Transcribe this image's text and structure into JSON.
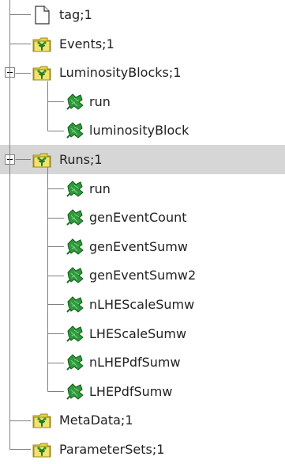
{
  "tree": {
    "nodes": [
      {
        "id": "tag",
        "label": "tag;1",
        "icon": "file-icon",
        "depth": 0,
        "selected": false
      },
      {
        "id": "events",
        "label": "Events;1",
        "icon": "tree-folder-icon",
        "depth": 0,
        "selected": false
      },
      {
        "id": "lumi",
        "label": "LuminosityBlocks;1",
        "icon": "tree-folder-icon",
        "depth": 0,
        "expanded": true,
        "selected": false
      },
      {
        "id": "lumi-run",
        "label": "run",
        "icon": "leaf-branch-icon",
        "depth": 1,
        "selected": false
      },
      {
        "id": "lumi-lb",
        "label": "luminosityBlock",
        "icon": "leaf-branch-icon",
        "depth": 1,
        "selected": false
      },
      {
        "id": "runs",
        "label": "Runs;1",
        "icon": "tree-folder-icon",
        "depth": 0,
        "expanded": true,
        "selected": true
      },
      {
        "id": "runs-run",
        "label": "run",
        "icon": "leaf-branch-icon",
        "depth": 1,
        "selected": false
      },
      {
        "id": "runs-gec",
        "label": "genEventCount",
        "icon": "leaf-branch-icon",
        "depth": 1,
        "selected": false
      },
      {
        "id": "runs-ges",
        "label": "genEventSumw",
        "icon": "leaf-branch-icon",
        "depth": 1,
        "selected": false
      },
      {
        "id": "runs-ges2",
        "label": "genEventSumw2",
        "icon": "leaf-branch-icon",
        "depth": 1,
        "selected": false
      },
      {
        "id": "runs-nlhes",
        "label": "nLHEScaleSumw",
        "icon": "leaf-branch-icon",
        "depth": 1,
        "selected": false
      },
      {
        "id": "runs-lhes",
        "label": "LHEScaleSumw",
        "icon": "leaf-branch-icon",
        "depth": 1,
        "selected": false
      },
      {
        "id": "runs-nlhep",
        "label": "nLHEPdfSumw",
        "icon": "leaf-branch-icon",
        "depth": 1,
        "selected": false
      },
      {
        "id": "runs-lhep",
        "label": "LHEPdfSumw",
        "icon": "leaf-branch-icon",
        "depth": 1,
        "selected": false
      },
      {
        "id": "meta",
        "label": "MetaData;1",
        "icon": "tree-folder-icon",
        "depth": 0,
        "selected": false
      },
      {
        "id": "params",
        "label": "ParameterSets;1",
        "icon": "tree-folder-icon",
        "depth": 0,
        "selected": false
      }
    ]
  },
  "colors": {
    "selection": "#d6d6d6",
    "guide_line": "#808080",
    "folder_fill": "#f2e36a",
    "leaf_green": "#2e9a3a"
  }
}
